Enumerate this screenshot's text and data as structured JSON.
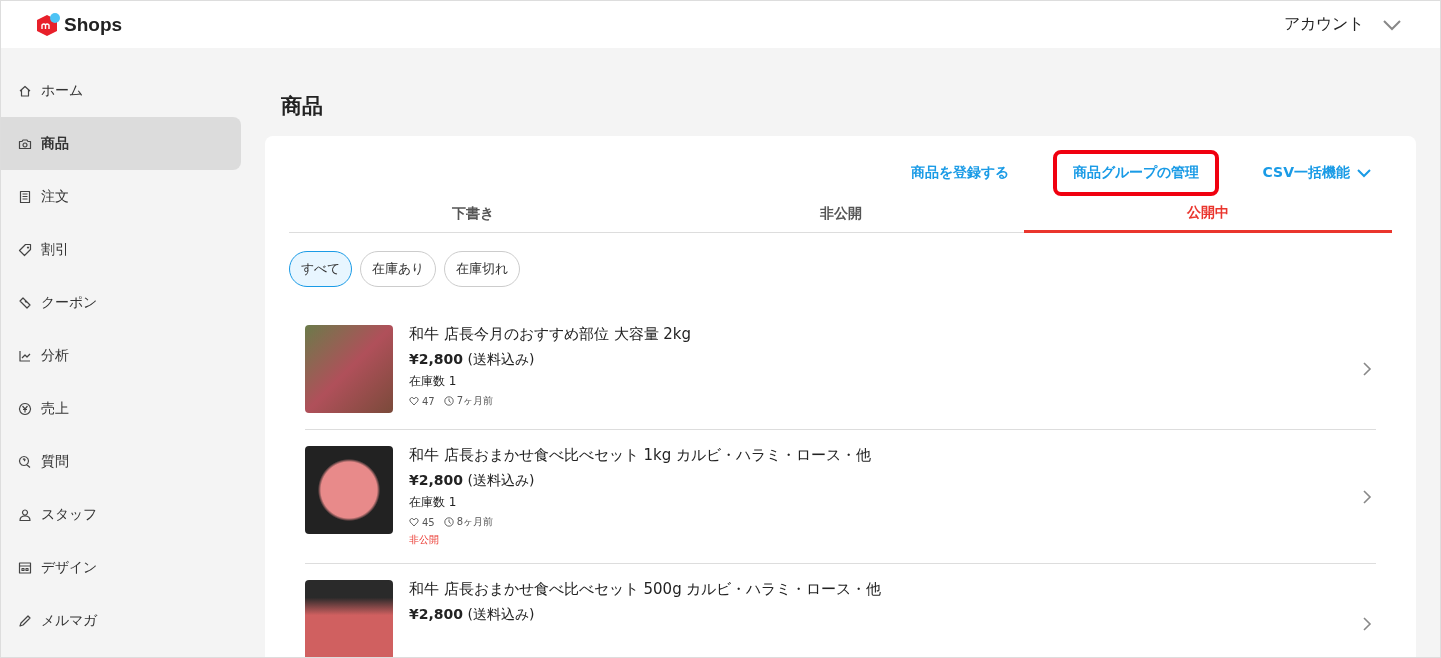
{
  "header": {
    "logo_text": "Shops",
    "account": "アカウント"
  },
  "sidebar": {
    "items": [
      {
        "label": "ホーム",
        "selected": false
      },
      {
        "label": "商品",
        "selected": true
      },
      {
        "label": "注文",
        "selected": false
      },
      {
        "label": "割引",
        "selected": false
      },
      {
        "label": "クーポン",
        "selected": false
      },
      {
        "label": "分析",
        "selected": false
      },
      {
        "label": "売上",
        "selected": false
      },
      {
        "label": "質問",
        "selected": false
      },
      {
        "label": "スタッフ",
        "selected": false
      },
      {
        "label": "デザイン",
        "selected": false
      },
      {
        "label": "メルマガ",
        "selected": false
      }
    ]
  },
  "page_title": "商品",
  "actions": [
    {
      "label": "商品を登録する",
      "highlighted": false,
      "dropdown": false
    },
    {
      "label": "商品グループの管理",
      "highlighted": true,
      "dropdown": false
    },
    {
      "label": "CSV一括機能",
      "highlighted": false,
      "dropdown": true
    }
  ],
  "tabs": [
    {
      "label": "下書き",
      "selected": false
    },
    {
      "label": "非公開",
      "selected": false
    },
    {
      "label": "公開中",
      "selected": true
    }
  ],
  "filters": [
    {
      "label": "すべて",
      "selected": true
    },
    {
      "label": "在庫あり",
      "selected": false
    },
    {
      "label": "在庫切れ",
      "selected": false
    }
  ],
  "products": [
    {
      "title": "和牛 店長今月のおすすめ部位 大容量 2kg",
      "price": "¥2,800",
      "price_note": "(送料込み)",
      "stock": "在庫数 1",
      "likes": "47",
      "age": "7ヶ月前"
    },
    {
      "title": "和牛 店長おまかせ食べ比べセット 1kg カルビ・ハラミ・ロース・他",
      "price": "¥2,800",
      "price_note": "(送料込み)",
      "stock": "在庫数 1",
      "likes": "45",
      "age": "8ヶ月前",
      "status": "非公開"
    },
    {
      "title": "和牛 店長おまかせ食べ比べセット 500g カルビ・ハラミ・ロース・他",
      "price": "¥2,800",
      "price_note": "(送料込み)"
    }
  ]
}
